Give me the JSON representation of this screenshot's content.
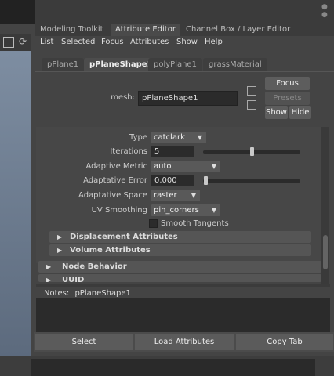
{
  "panel_tabs": [
    "Modeling Toolkit",
    "Attribute Editor",
    "Channel Box / Layer Editor"
  ],
  "menu": [
    "List",
    "Selected",
    "Focus",
    "Attributes",
    "Show",
    "Help"
  ],
  "node_tabs": [
    "pPlane1",
    "pPlaneShape1",
    "polyPlane1",
    "grassMaterial"
  ],
  "mesh": {
    "label": "mesh:",
    "value": "pPlaneShape1"
  },
  "right_buttons": {
    "focus": "Focus",
    "presets": "Presets",
    "show": "Show",
    "hide": "Hide"
  },
  "attributes": {
    "type": {
      "label": "Type",
      "value": "catclark"
    },
    "iterations": {
      "label": "Iterations",
      "value": "5",
      "slider_fraction": 0.5
    },
    "adaptive_metric": {
      "label": "Adaptive Metric",
      "value": "auto"
    },
    "adaptive_error": {
      "label": "Adaptative Error",
      "value": "0.000",
      "slider_fraction": 0.0
    },
    "adaptive_space": {
      "label": "Adaptative Space",
      "value": "raster"
    },
    "uv_smoothing": {
      "label": "UV Smoothing",
      "value": "pin_corners"
    },
    "smooth_tangents": {
      "label": "Smooth Tangents",
      "checked": false
    }
  },
  "sections": {
    "displacement": "Displacement Attributes",
    "volume": "Volume Attributes",
    "node_behavior": "Node Behavior",
    "uuid": "UUID"
  },
  "notes": {
    "label": "Notes:",
    "value": "pPlaneShape1"
  },
  "bottom_buttons": {
    "select": "Select",
    "load": "Load Attributes",
    "copy": "Copy Tab"
  }
}
